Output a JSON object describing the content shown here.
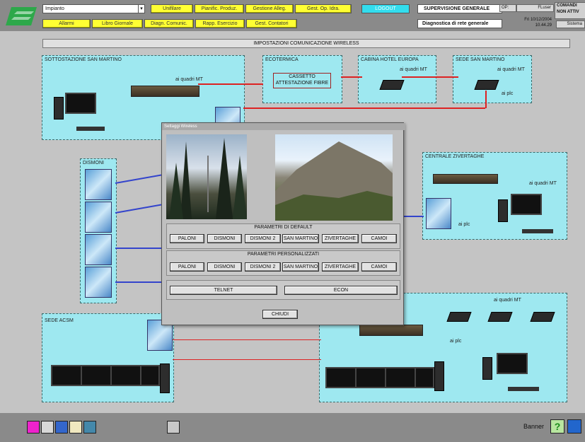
{
  "topbar": {
    "impianto": "Impianto",
    "buttons_row1": [
      "Unifilare",
      "Pianific. Produz.",
      "Gestione Alleg.",
      "Gest. Op. Idra."
    ],
    "logout": "LOGOUT",
    "supervisione": "SUPERVISIONE GENERALE",
    "op_label": "OP:",
    "user": "FLuser",
    "comandi": "COMANDI",
    "non_attivi": "NON ATTIV",
    "buttons_row2": [
      "Allarmi",
      "Libro Giornale",
      "Diagn. Comunic.",
      "Rapp. Esercizio",
      "Gest. Contatori"
    ],
    "diagnostica": "Diagnostica di rete generale",
    "date": "Fri 10/12/2004",
    "time": "10.44.29",
    "sistema": "Sistema"
  },
  "main_title": "IMPOSTAZIONI COMUNICAZIONE WIRELESS",
  "panels": {
    "sottostazione": "SOTTOSTAZIONE SAN MARTINO",
    "ecotermica": "ECOTERMICA",
    "cabina": "CABINA HOTEL EUROPA",
    "sede_sm": "SEDE SAN MARTINO",
    "dismoni": "DISMONI",
    "centrale": "CENTRALE ZIVERTAGHE",
    "sede_acsm": "SEDE ACSM"
  },
  "labels": {
    "ai_quadri_mt": "ai quadri MT",
    "ai_plc": "ai plc",
    "cassetto": "CASSETTO",
    "attestazione": "ATTESTAZIONE FIBRE"
  },
  "dialog": {
    "title": "Settaggi Wireless",
    "default_title": "PARAMETRI DI DEFAULT",
    "custom_title": "PARAMETRI PERSONALIZZATI",
    "sites": [
      "PALONI",
      "DISMONI",
      "DISMONI 2",
      "SAN MARTINO",
      "ZIVERTAGHE",
      "CAMOI"
    ],
    "telnet": "TELNET",
    "econ": "ECON",
    "close": "CHIUDI"
  },
  "bottom": {
    "banner": "Banner",
    "help": "?"
  },
  "colors": {
    "yellow": "#ffff33",
    "cyan_panel": "#9ee8f0",
    "red_line": "#dd2222",
    "blue_line": "#3344cc"
  }
}
